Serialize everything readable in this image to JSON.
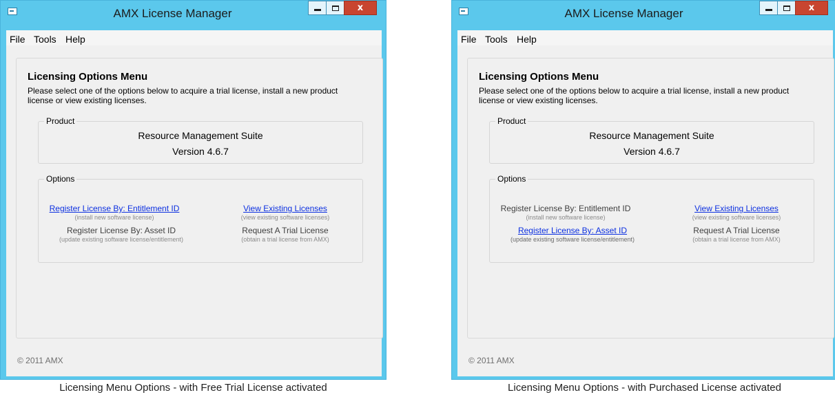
{
  "panels": [
    {
      "window": {
        "title": "AMX License Manager",
        "menu": [
          "File",
          "Tools",
          "Help"
        ],
        "heading": "Licensing Options Menu",
        "description": "Please select one of the options below to acquire a trial license, install a new product license or view existing licenses.",
        "product_group_label": "Product",
        "product_name": "Resource Management Suite",
        "product_version": "Version 4.6.7",
        "options_group_label": "Options",
        "options": {
          "entitlement": {
            "label": "Register License By:  Entitlement ID",
            "sub": "(install new software license)",
            "enabled": true
          },
          "asset": {
            "label": "Register License By:  Asset ID",
            "sub": "(update existing software license/entitlement)",
            "enabled": false
          },
          "view": {
            "label": "View Existing Licenses",
            "sub": "(view existing software licenses)",
            "enabled": true
          },
          "trial": {
            "label": "Request A Trial License",
            "sub": "(obtain a trial license from AMX)",
            "enabled": false
          }
        },
        "footer": "© 2011 AMX",
        "close_glyph": "x"
      },
      "caption": "Licensing Menu Options - with Free Trial License activated"
    },
    {
      "window": {
        "title": "AMX License Manager",
        "menu": [
          "File",
          "Tools",
          "Help"
        ],
        "heading": "Licensing Options Menu",
        "description": "Please select one of the options below to acquire a trial license, install a new product license or view existing licenses.",
        "product_group_label": "Product",
        "product_name": "Resource Management Suite",
        "product_version": "Version 4.6.7",
        "options_group_label": "Options",
        "options": {
          "entitlement": {
            "label": "Register License By:  Entitlement ID",
            "sub": "(install new software license)",
            "enabled": false
          },
          "asset": {
            "label": "Register License By:  Asset ID",
            "sub": "(update existing software license/entitlement)",
            "enabled": true
          },
          "view": {
            "label": "View Existing Licenses",
            "sub": "(view existing software licenses)",
            "enabled": true
          },
          "trial": {
            "label": "Request A Trial License",
            "sub": "(obtain a trial license from AMX)",
            "enabled": false
          }
        },
        "footer": "© 2011 AMX",
        "close_glyph": "x"
      },
      "caption": "Licensing Menu Options - with Purchased License activated"
    }
  ],
  "colors": {
    "window_frame": "#5bc8ec",
    "link": "#0b2fe0",
    "close_button": "#c84530"
  }
}
